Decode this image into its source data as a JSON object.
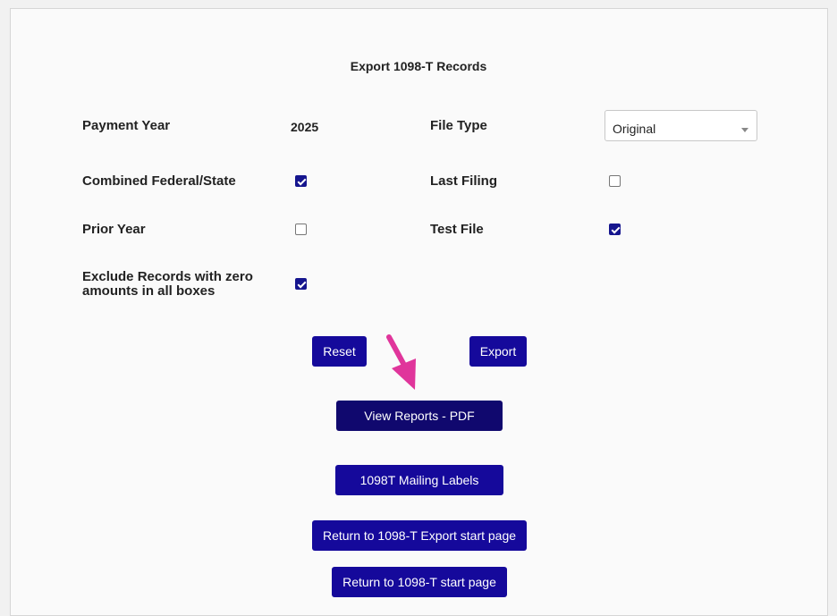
{
  "page_title": "Export 1098-T Records",
  "fields": {
    "payment_year": {
      "label": "Payment Year",
      "value": "2025"
    },
    "file_type": {
      "label": "File Type",
      "selected": "Original"
    },
    "combined_federal_state": {
      "label": "Combined Federal/State",
      "checked": true
    },
    "last_filing": {
      "label": "Last Filing",
      "checked": false
    },
    "prior_year": {
      "label": "Prior Year",
      "checked": false
    },
    "test_file": {
      "label": "Test File",
      "checked": true
    },
    "exclude_zero": {
      "label_line1": "Exclude Records with zero",
      "label_line2": "amounts in all boxes",
      "checked": true
    }
  },
  "buttons": {
    "reset": "Reset",
    "export": "Export",
    "view_reports_pdf": "View Reports - PDF",
    "mailing_labels": "1098T Mailing Labels",
    "return_export_start": "Return to 1098-T Export start page",
    "return_start": "Return to 1098-T start page"
  },
  "colors": {
    "button": "#15099b",
    "button_hover": "#10086e",
    "checkbox": "#15158e",
    "annotation_arrow": "#e0359b"
  },
  "icons": {
    "annotation": "arrow-pointer-icon",
    "dropdown": "chevron-down-icon"
  }
}
